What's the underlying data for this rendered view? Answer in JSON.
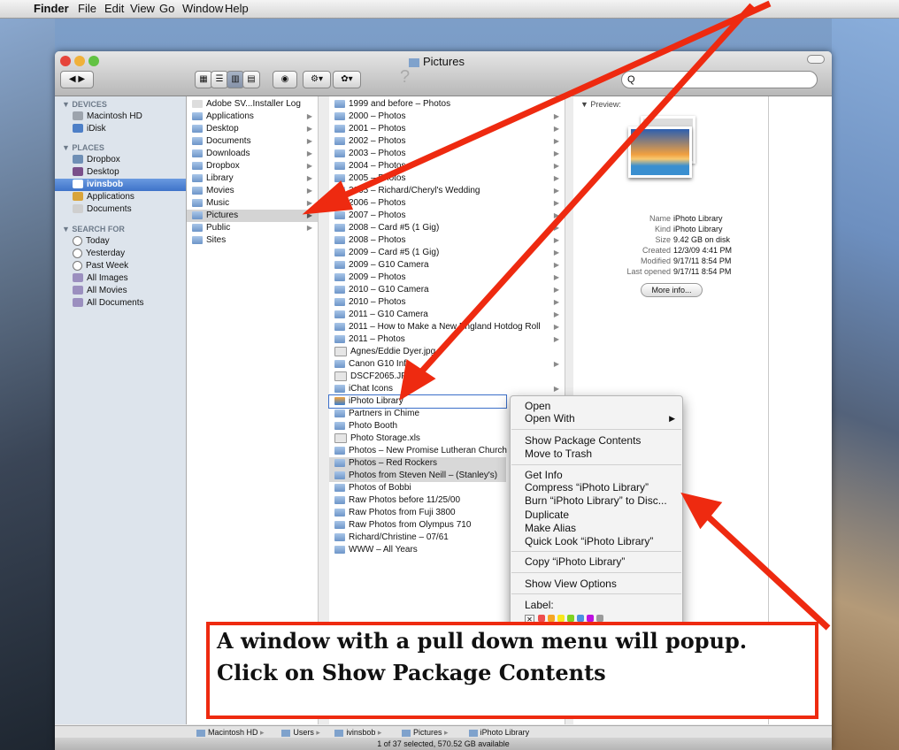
{
  "menubar": {
    "apple": "",
    "app": "Finder",
    "items": [
      "File",
      "Edit",
      "View",
      "Go",
      "Window",
      "Help"
    ]
  },
  "window": {
    "title": "Pictures",
    "search_placeholder": "Q",
    "help": "?"
  },
  "sidebar": {
    "devices_header": "▼ DEVICES",
    "devices": [
      "Macintosh HD",
      "iDisk"
    ],
    "places_header": "▼ PLACES",
    "places": [
      "Dropbox",
      "Desktop",
      "ivinsbob",
      "Applications",
      "Documents"
    ],
    "search_header": "▼ SEARCH FOR",
    "search": [
      "Today",
      "Yesterday",
      "Past Week",
      "All Images",
      "All Movies",
      "All Documents"
    ]
  },
  "column1": [
    "Adobe SV...Installer Log",
    "Applications",
    "Desktop",
    "Documents",
    "Downloads",
    "Dropbox",
    "Library",
    "Movies",
    "Music",
    "Pictures",
    "Public",
    "Sites"
  ],
  "column2": [
    "1999 and before – Photos",
    "2000 – Photos",
    "2001 – Photos",
    "2002 – Photos",
    "2003 – Photos",
    "2004 – Photos",
    "2005 – Photos",
    "2005 – Richard/Cheryl's Wedding",
    "2006 – Photos",
    "2007 – Photos",
    "2008 – Card #5 (1 Gig)",
    "2008 – Photos",
    "2009 – Card #5 (1 Gig)",
    "2009 – G10 Camera",
    "2009 – Photos",
    "2010 – G10 Camera",
    "2010 – Photos",
    "2011 – G10 Camera",
    "2011 – How to Make a New England Hotdog Roll",
    "2011 – Photos",
    "Agnes/Eddie Dyer.jpg",
    "Canon G10 Info",
    "DSCF2065.JPG",
    "iChat Icons",
    "iPhoto Library",
    "Partners in Chime",
    "Photo Booth",
    "Photo Storage.xls",
    "Photos – New Promise Lutheran Church",
    "Photos – Red Rockers",
    "Photos from Steven Neill – (Stanley's)",
    "Photos of Bobbi",
    "Raw Photos before 11/25/00",
    "Raw Photos from Fuji 3800",
    "Raw Photos from Olympus 710",
    "Richard/Christine – 07/61",
    "WWW – All Years"
  ],
  "preview": {
    "header": "▼ Preview:",
    "labels": [
      "Name",
      "Kind",
      "Size",
      "Created",
      "Modified",
      "Last opened"
    ],
    "values": [
      "iPhoto Library",
      "iPhoto Library",
      "9.42 GB on disk",
      "12/3/09 4:41 PM",
      "9/17/11 8:54 PM",
      "9/17/11 8:54 PM"
    ],
    "more_info": "More info..."
  },
  "context_menu": {
    "items": [
      "Open",
      "Open With",
      "Show Package Contents",
      "Move to Trash",
      "Get Info",
      "Compress “iPhoto Library”",
      "Burn “iPhoto Library” to Disc...",
      "Duplicate",
      "Make Alias",
      "Quick Look “iPhoto Library”",
      "Copy “iPhoto Library”",
      "Show View Options",
      "Label:"
    ],
    "submenu_arrow": "▶",
    "label_colors": [
      "#ee4d4d",
      "#f5a623",
      "#f8e71c",
      "#7ed321",
      "#4a90e2",
      "#bd10e0",
      "#9b9b9b"
    ]
  },
  "pathbar": [
    "Macintosh HD",
    "Users",
    "ivinsbob",
    "Pictures",
    "iPhoto Library"
  ],
  "status": "1 of 37 selected, 570.52 GB available",
  "annotation": {
    "line1": "A window with a pull down menu will popup.",
    "line2": "Click on Show Package Contents",
    "color": "#ee2a10"
  }
}
